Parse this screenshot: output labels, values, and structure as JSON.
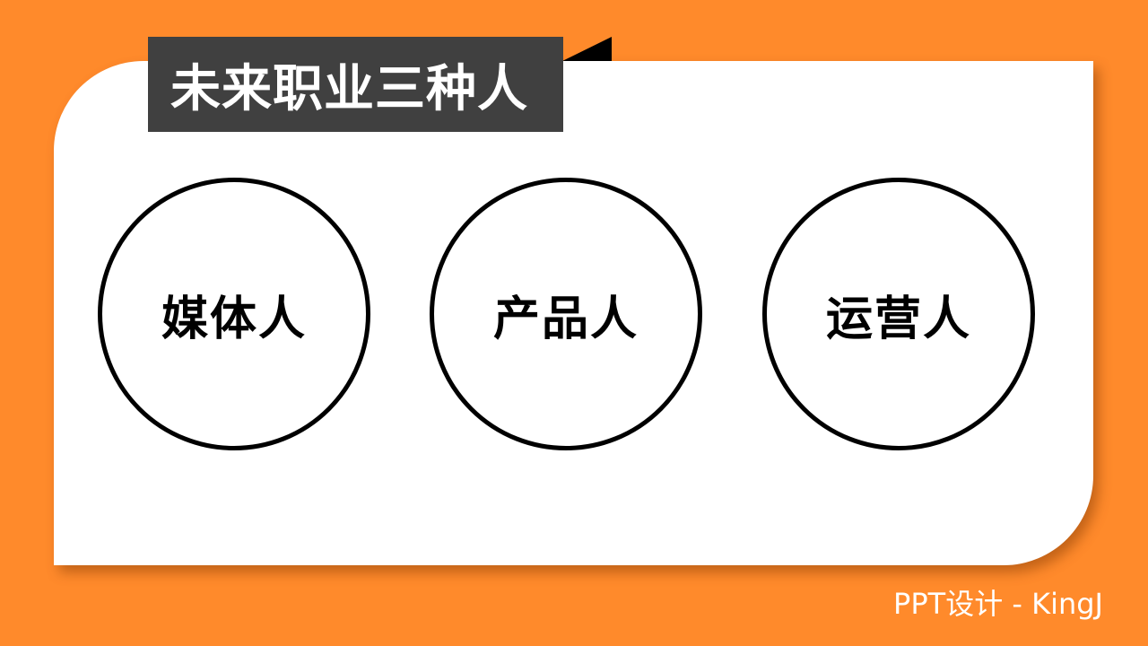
{
  "slide": {
    "title": "未来职业三种人",
    "items": [
      {
        "label": "媒体人"
      },
      {
        "label": "产品人"
      },
      {
        "label": "运营人"
      }
    ],
    "footer": "PPT设计 - KingJ"
  },
  "colors": {
    "background": "#FF8A2B",
    "card": "#FFFFFF",
    "title_bar": "#404040",
    "title_text": "#FFFFFF",
    "circle_border": "#000000",
    "circle_text": "#000000"
  }
}
